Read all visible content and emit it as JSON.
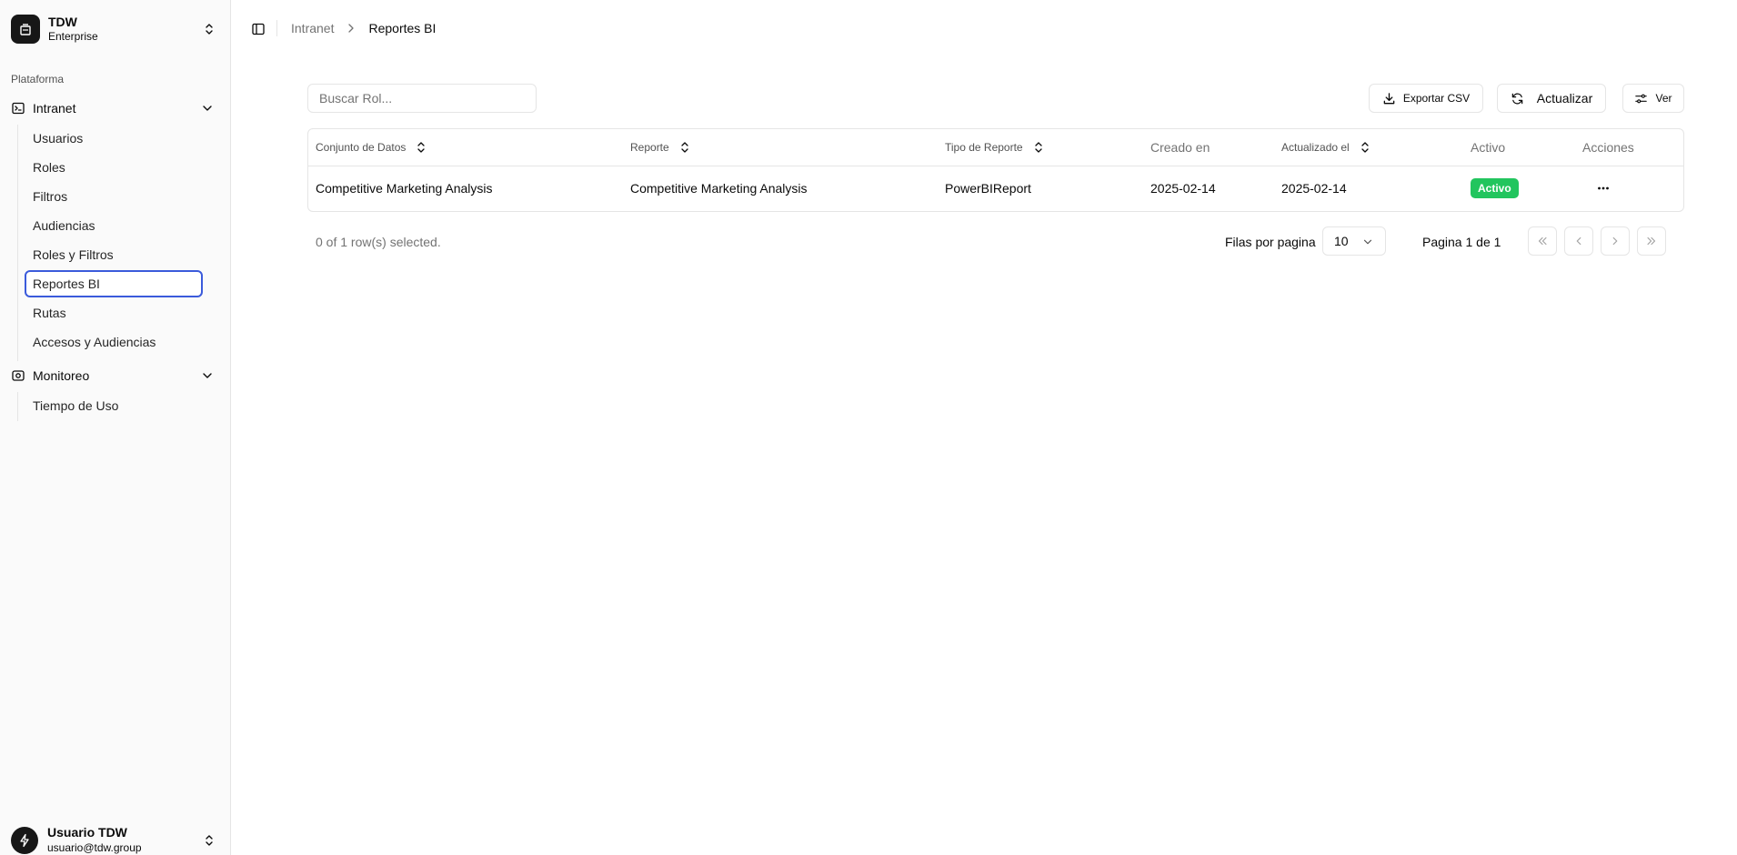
{
  "team": {
    "name": "TDW",
    "plan": "Enterprise"
  },
  "sidebar": {
    "group_label": "Plataforma",
    "sections": [
      {
        "label": "Intranet",
        "items": [
          {
            "label": "Usuarios"
          },
          {
            "label": "Roles"
          },
          {
            "label": "Filtros"
          },
          {
            "label": "Audiencias"
          },
          {
            "label": "Roles y Filtros"
          },
          {
            "label": "Reportes BI",
            "active": true
          },
          {
            "label": "Rutas"
          },
          {
            "label": "Accesos y Audiencias"
          }
        ]
      },
      {
        "label": "Monitoreo",
        "items": [
          {
            "label": "Tiempo de Uso"
          }
        ]
      }
    ]
  },
  "user": {
    "name": "Usuario TDW",
    "email": "usuario@tdw.group"
  },
  "breadcrumb": {
    "parent": "Intranet",
    "current": "Reportes BI"
  },
  "toolbar": {
    "search_placeholder": "Buscar Rol...",
    "export_label": "Exportar CSV",
    "refresh_label": "Actualizar",
    "view_label": "Ver"
  },
  "table": {
    "columns": {
      "dataset": "Conjunto de Datos",
      "report": "Reporte",
      "report_type": "Tipo de Reporte",
      "created": "Creado en",
      "updated": "Actualizado el",
      "active": "Activo",
      "actions": "Acciones"
    },
    "rows": [
      {
        "dataset": "Competitive Marketing Analysis",
        "report": "Competitive Marketing Analysis",
        "report_type": "PowerBIReport",
        "created": "2025-02-14",
        "updated": "2025-02-14",
        "status": "Activo"
      }
    ]
  },
  "footer": {
    "selection_text": "0 of 1 row(s) selected.",
    "rows_per_page_label": "Filas por pagina",
    "rows_per_page_value": "10",
    "page_text": "Pagina 1 de 1"
  },
  "colors": {
    "status_active": "#22c55e",
    "focus_ring": "#3b5bdb",
    "brand_dark": "#171717"
  },
  "icons": [
    "building-icon",
    "chevrons-updown-icon",
    "terminal-icon",
    "chevron-down-icon",
    "monitor-icon",
    "sidebar-toggle-icon",
    "chevron-right-icon",
    "download-icon",
    "refresh-icon",
    "sliders-icon",
    "sort-icon",
    "more-horizontal-icon",
    "chevrons-left-icon",
    "chevron-left-icon",
    "chevrons-right-icon",
    "bolt-icon"
  ]
}
